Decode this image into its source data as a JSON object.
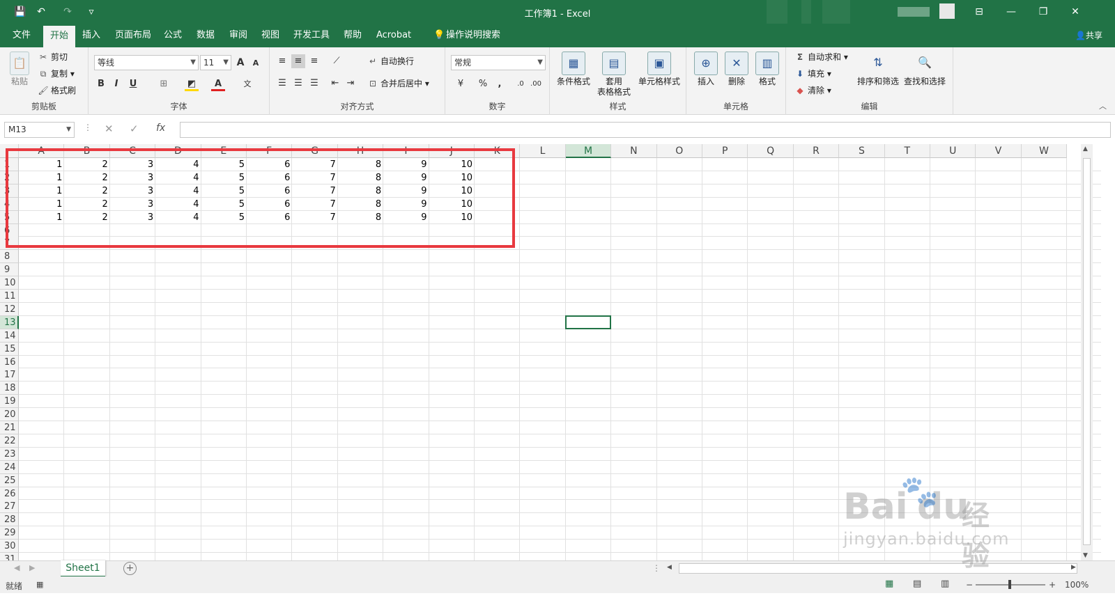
{
  "window": {
    "title": "工作簿1  -  Excel",
    "minimize": "—",
    "restore": "❐",
    "close": "✕",
    "ribbon_display": "⊟"
  },
  "qat": {
    "save": "💾",
    "undo": "↶",
    "redo": "↷",
    "customize": "▿"
  },
  "tabs": [
    "文件",
    "开始",
    "插入",
    "页面布局",
    "公式",
    "数据",
    "审阅",
    "视图",
    "开发工具",
    "帮助",
    "Acrobat"
  ],
  "active_tab": "开始",
  "tell_me": "操作说明搜索",
  "share": "共享",
  "ribbon": {
    "clipboard": {
      "label": "剪贴板",
      "paste": "粘贴",
      "cut": "剪切",
      "copy": "复制",
      "format_painter": "格式刷"
    },
    "font": {
      "label": "字体",
      "font_name": "等线",
      "font_size": "11",
      "bold": "B",
      "italic": "I",
      "underline": "U",
      "grow": "A",
      "shrink": "A"
    },
    "alignment": {
      "label": "对齐方式",
      "wrap": "自动换行",
      "merge": "合并后居中"
    },
    "number": {
      "label": "数字",
      "format": "常规",
      "percent": "%",
      "comma": ","
    },
    "styles": {
      "label": "样式",
      "conditional": "条件格式",
      "table_1": "套用",
      "table_2": "表格格式",
      "cell_styles": "单元格样式"
    },
    "cells": {
      "label": "单元格",
      "insert": "插入",
      "delete": "删除",
      "format": "格式"
    },
    "editing": {
      "label": "编辑",
      "autosum": "自动求和",
      "fill": "填充",
      "clear": "清除",
      "sort": "排序和筛选",
      "find": "查找和选择"
    }
  },
  "namebox": "M13",
  "fx": "fx",
  "columns": [
    "A",
    "B",
    "C",
    "D",
    "E",
    "F",
    "G",
    "H",
    "I",
    "J",
    "K",
    "L",
    "M",
    "N",
    "O",
    "P",
    "Q",
    "R",
    "S",
    "T",
    "U",
    "V",
    "W"
  ],
  "selected_column": "M",
  "selected_row": "13",
  "rows": [
    "1",
    "2",
    "3",
    "4",
    "5",
    "6",
    "7",
    "8",
    "9",
    "10",
    "11",
    "12",
    "13",
    "14",
    "15",
    "16",
    "17",
    "18",
    "19",
    "20",
    "21",
    "22",
    "23",
    "24",
    "25",
    "26",
    "27",
    "28",
    "29",
    "30",
    "31"
  ],
  "cells": [
    [
      "1",
      "2",
      "3",
      "4",
      "5",
      "6",
      "7",
      "8",
      "9",
      "10"
    ],
    [
      "1",
      "2",
      "3",
      "4",
      "5",
      "6",
      "7",
      "8",
      "9",
      "10"
    ],
    [
      "1",
      "2",
      "3",
      "4",
      "5",
      "6",
      "7",
      "8",
      "9",
      "10"
    ],
    [
      "1",
      "2",
      "3",
      "4",
      "5",
      "6",
      "7",
      "8",
      "9",
      "10"
    ],
    [
      "1",
      "2",
      "3",
      "4",
      "5",
      "6",
      "7",
      "8",
      "9",
      "10"
    ]
  ],
  "sheet_tab": "Sheet1",
  "add_sheet": "+",
  "status": {
    "ready": "就绪",
    "zoom": "100%"
  },
  "watermark": {
    "brand": "Bai",
    "brand_du": "du",
    "brand_cn": "经验",
    "url": "jingyan.baidu.com"
  },
  "colors": {
    "excel_green": "#217346",
    "highlight_box": "#e8393f"
  }
}
